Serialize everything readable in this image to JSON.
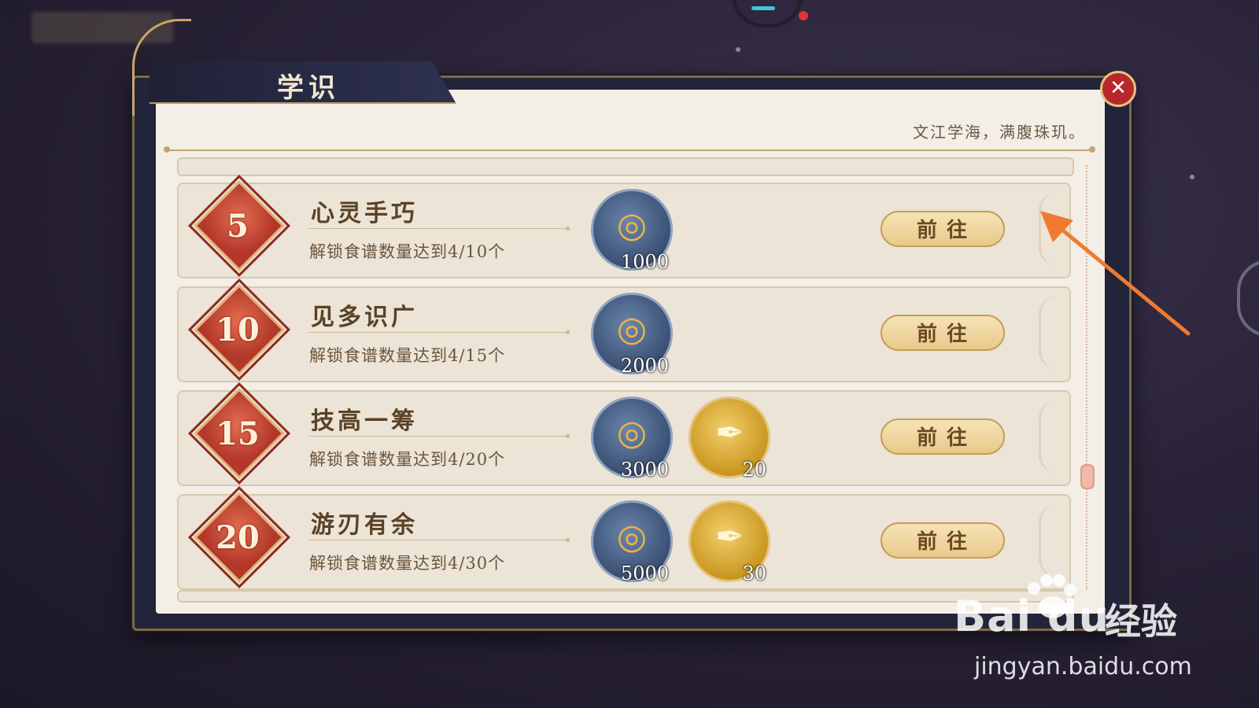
{
  "panel": {
    "title": "学识",
    "motto": "文江学海，满腹珠玑。",
    "close_glyph": "✕"
  },
  "achievements": [
    {
      "level": "5",
      "name": "心灵手巧",
      "desc": "解锁食谱数量达到4/10个",
      "rewards": [
        {
          "icon": "coin-bag-icon",
          "amount": "1000"
        }
      ],
      "button": "前往"
    },
    {
      "level": "10",
      "name": "见多识广",
      "desc": "解锁食谱数量达到4/15个",
      "rewards": [
        {
          "icon": "coin-bag-icon",
          "amount": "2000"
        }
      ],
      "button": "前往"
    },
    {
      "level": "15",
      "name": "技高一筹",
      "desc": "解锁食谱数量达到4/20个",
      "rewards": [
        {
          "icon": "coin-bag-icon",
          "amount": "3000"
        },
        {
          "icon": "quill-icon",
          "amount": "20"
        }
      ],
      "button": "前往"
    },
    {
      "level": "20",
      "name": "游刃有余",
      "desc": "解锁食谱数量达到4/30个",
      "rewards": [
        {
          "icon": "coin-bag-icon",
          "amount": "5000"
        },
        {
          "icon": "quill-icon",
          "amount": "30"
        }
      ],
      "button": "前往"
    }
  ],
  "watermark": {
    "logo": "Bai du",
    "cn": "经验",
    "url": "jingyan.baidu.com"
  },
  "colors": {
    "annotation_arrow": "#f07a30",
    "close_button": "#b7282a",
    "badge": "#c6432f"
  }
}
